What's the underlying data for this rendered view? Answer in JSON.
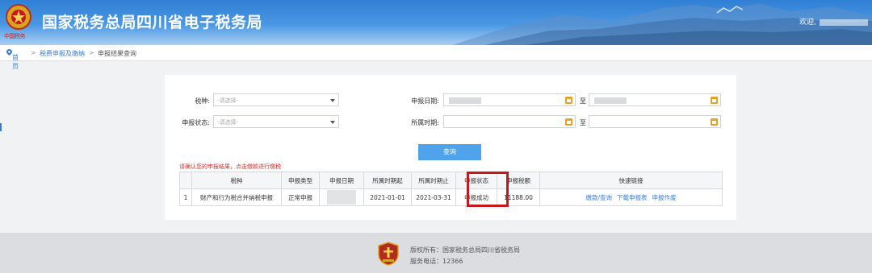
{
  "header": {
    "title": "国家税务总局四川省电子税务局",
    "slogan": "中国税务",
    "welcome": "欢迎,"
  },
  "breadcrumb": {
    "home": "首页",
    "level2": "税费申报及缴纳",
    "separator": ">",
    "level3": "申报结果查询"
  },
  "form": {
    "tax_type_label": "税种:",
    "tax_type_placeholder": "-请选择-",
    "status_label": "申报状态:",
    "status_placeholder": "-请选择-",
    "date_label": "申报日期:",
    "period_label": "所属时期:",
    "to_label": "至",
    "query_button": "查询"
  },
  "notice": "请确认您的申报结果，点击缴款进行缴税",
  "table": {
    "headers": [
      "",
      "税种",
      "申报类型",
      "申报日期",
      "所属时期起",
      "所属时期止",
      "申报状态",
      "申报税额",
      "快速链接"
    ],
    "row": {
      "index": "1",
      "tax": "财产和行为税合并纳税申报",
      "type": "正常申报",
      "start": "2021-01-01",
      "end": "2021-03-31",
      "status": "申报成功",
      "amount": "11188.00",
      "link_pay": "缴款/查询",
      "link_download": "下载申报表",
      "link_void": "申报作废"
    }
  },
  "footer": {
    "copyright": "版权所有：国家税务总局四川省税务局",
    "phone": "服务电话：12366"
  },
  "colors": {
    "header_blue": "#2f7fd6",
    "button_blue": "#4fa3ea",
    "link_blue": "#3a7bd5",
    "notice_red": "#d9302a",
    "highlight_red": "#c8161d",
    "calendar_orange": "#e8a12a"
  }
}
